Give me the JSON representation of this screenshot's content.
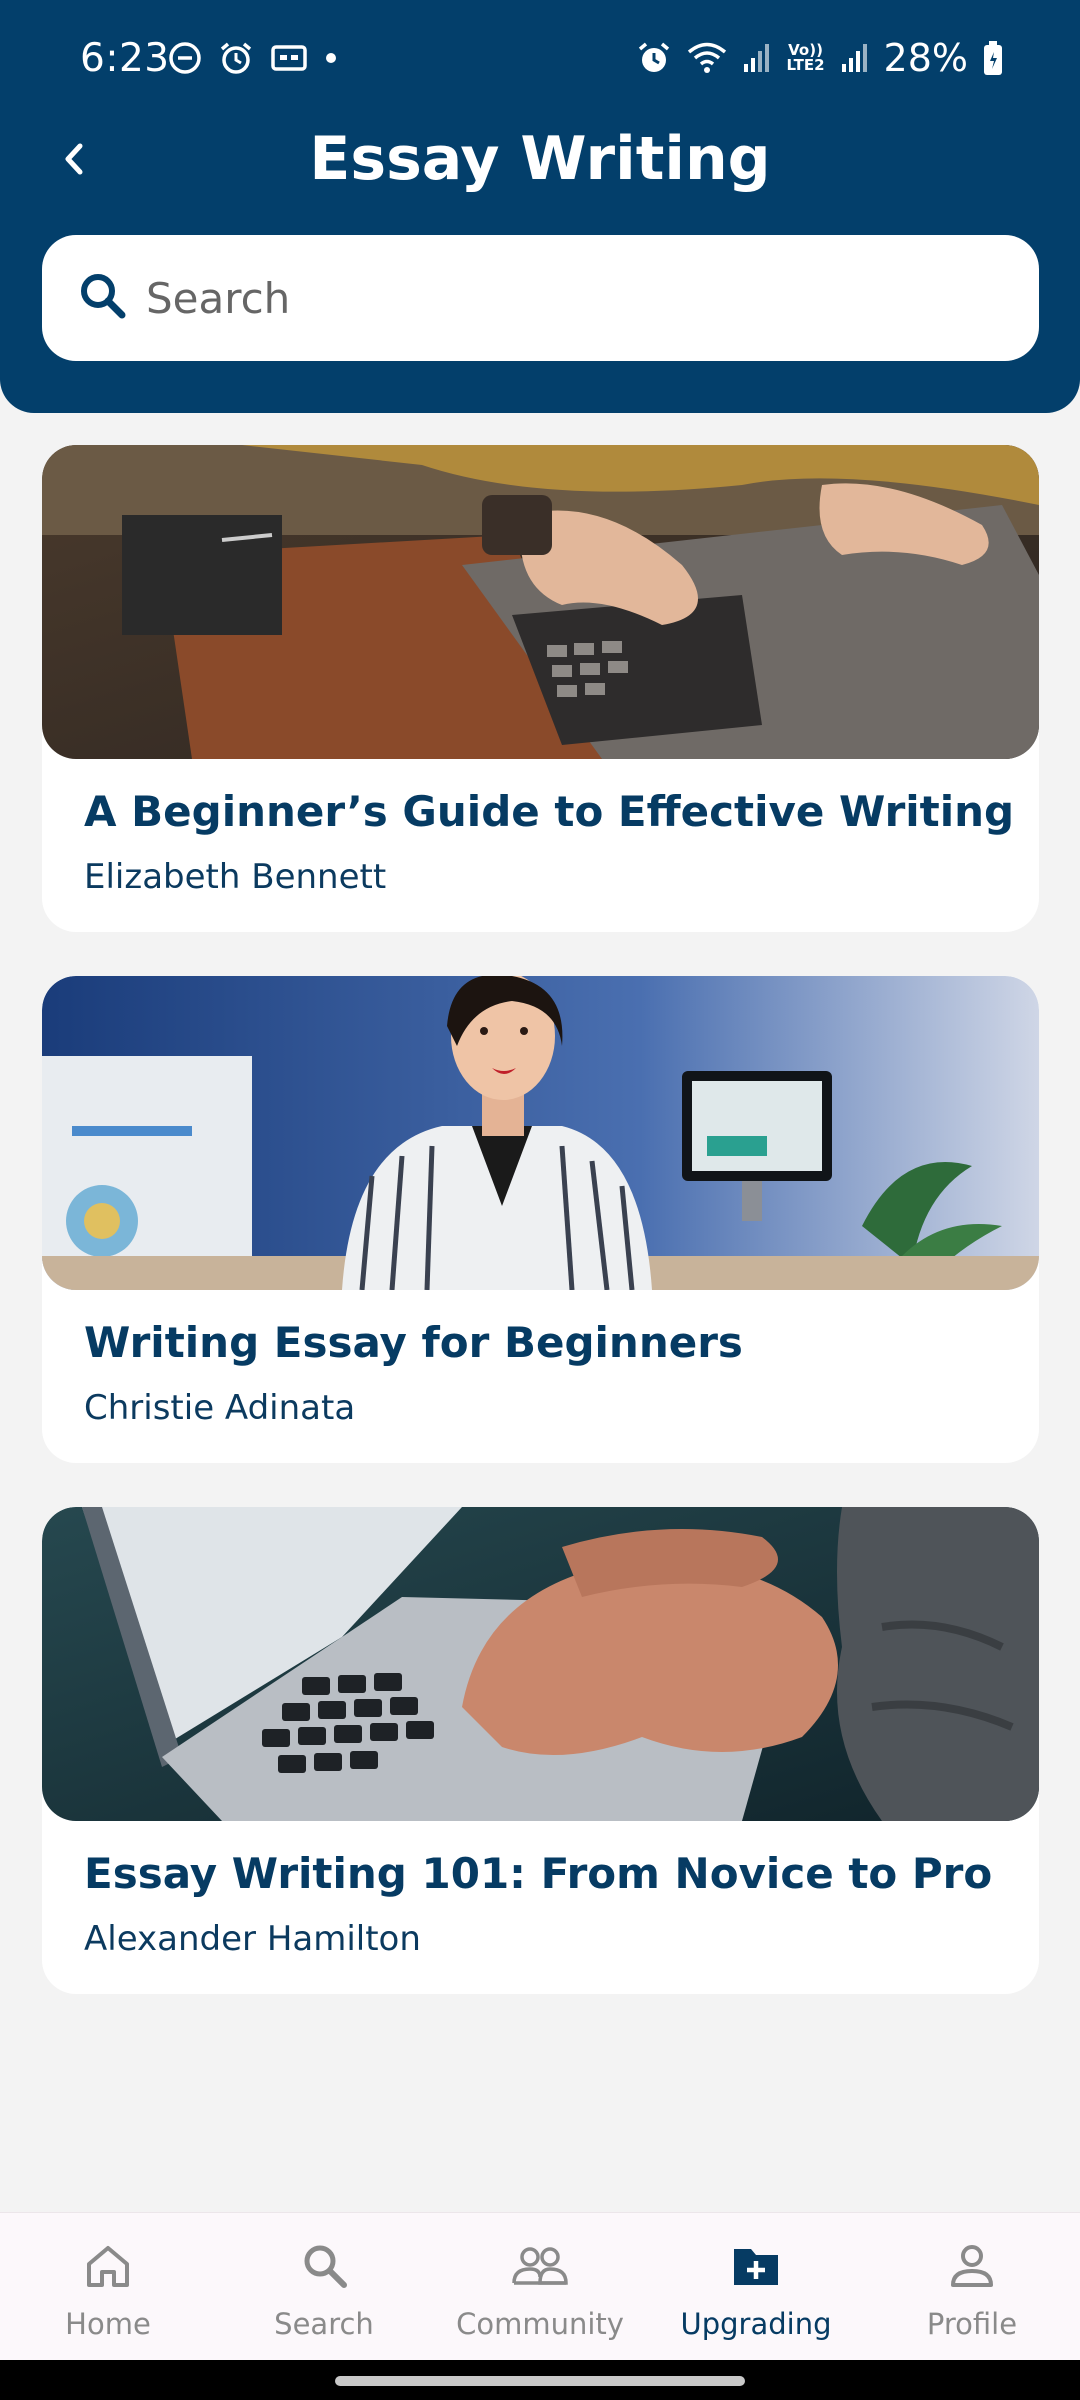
{
  "status_bar": {
    "time": "6:23",
    "battery": "28%",
    "left_icons": [
      "do-not-disturb-icon",
      "alarm-icon",
      "cast-icon",
      "dot-icon"
    ],
    "right_icons": [
      "alarm-icon",
      "wifi-icon",
      "signal-icon",
      "volte-icon",
      "signal-icon",
      "battery-icon"
    ],
    "volte_label": "Vo)) LTE2"
  },
  "header": {
    "title": "Essay Writing",
    "back_icon": "chevron-left-icon"
  },
  "search": {
    "placeholder": "Search",
    "value": ""
  },
  "courses": [
    {
      "title": "A Beginner’s Guide to Effective Writing",
      "author": "Elizabeth Bennett"
    },
    {
      "title": "Writing Essay for Beginners",
      "author": "Christie Adinata"
    },
    {
      "title": "Essay Writing 101: From Novice to Pro",
      "author": "Alexander Hamilton"
    }
  ],
  "bottom_nav": {
    "active": "Upgrading",
    "items": [
      {
        "label": "Home",
        "icon": "home-icon"
      },
      {
        "label": "Search",
        "icon": "search-icon"
      },
      {
        "label": "Community",
        "icon": "community-icon"
      },
      {
        "label": "Upgrading",
        "icon": "folder-plus-icon"
      },
      {
        "label": "Profile",
        "icon": "profile-icon"
      }
    ]
  },
  "colors": {
    "header_bg": "#033f6b",
    "page_bg": "#f3f3f3",
    "title_text": "#063b63",
    "nav_active": "#063b63",
    "nav_inactive": "#8a8a8a"
  }
}
